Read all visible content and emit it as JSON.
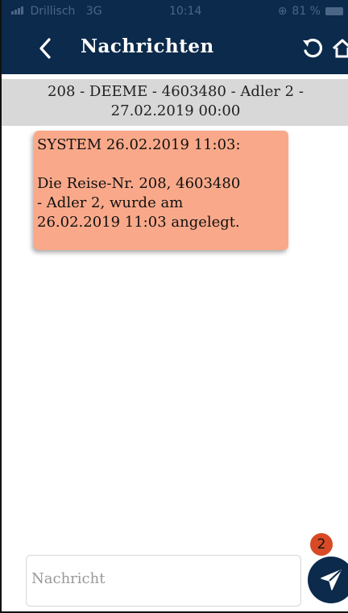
{
  "status_bar": {
    "carrier": "Drillisch",
    "network": "3G",
    "time": "10:14",
    "battery": "81 %"
  },
  "app_bar": {
    "title": "Nachrichten",
    "back_icon": "chevron-left-icon",
    "reload_icon": "reload-icon",
    "home_icon": "home-icon"
  },
  "conversation": {
    "header_line1": "208 - DEEME - 4603480 - Adler 2 -",
    "header_line2": "27.02.2019 00:00"
  },
  "messages": [
    {
      "header": "SYSTEM 26.02.2019 11:03:",
      "body_lines": [
        "Die Reise-Nr. 208, 4603480",
        "- Adler 2, wurde am",
        "26.02.2019 11:03 angelegt."
      ]
    }
  ],
  "composer": {
    "placeholder": "Nachricht",
    "send_icon": "send-icon",
    "badge_count": "2"
  },
  "colors": {
    "navy": "#0c2a4b",
    "bubble": "#f9a98a",
    "subheader": "#d8d8d8",
    "badge": "#d84a25"
  }
}
